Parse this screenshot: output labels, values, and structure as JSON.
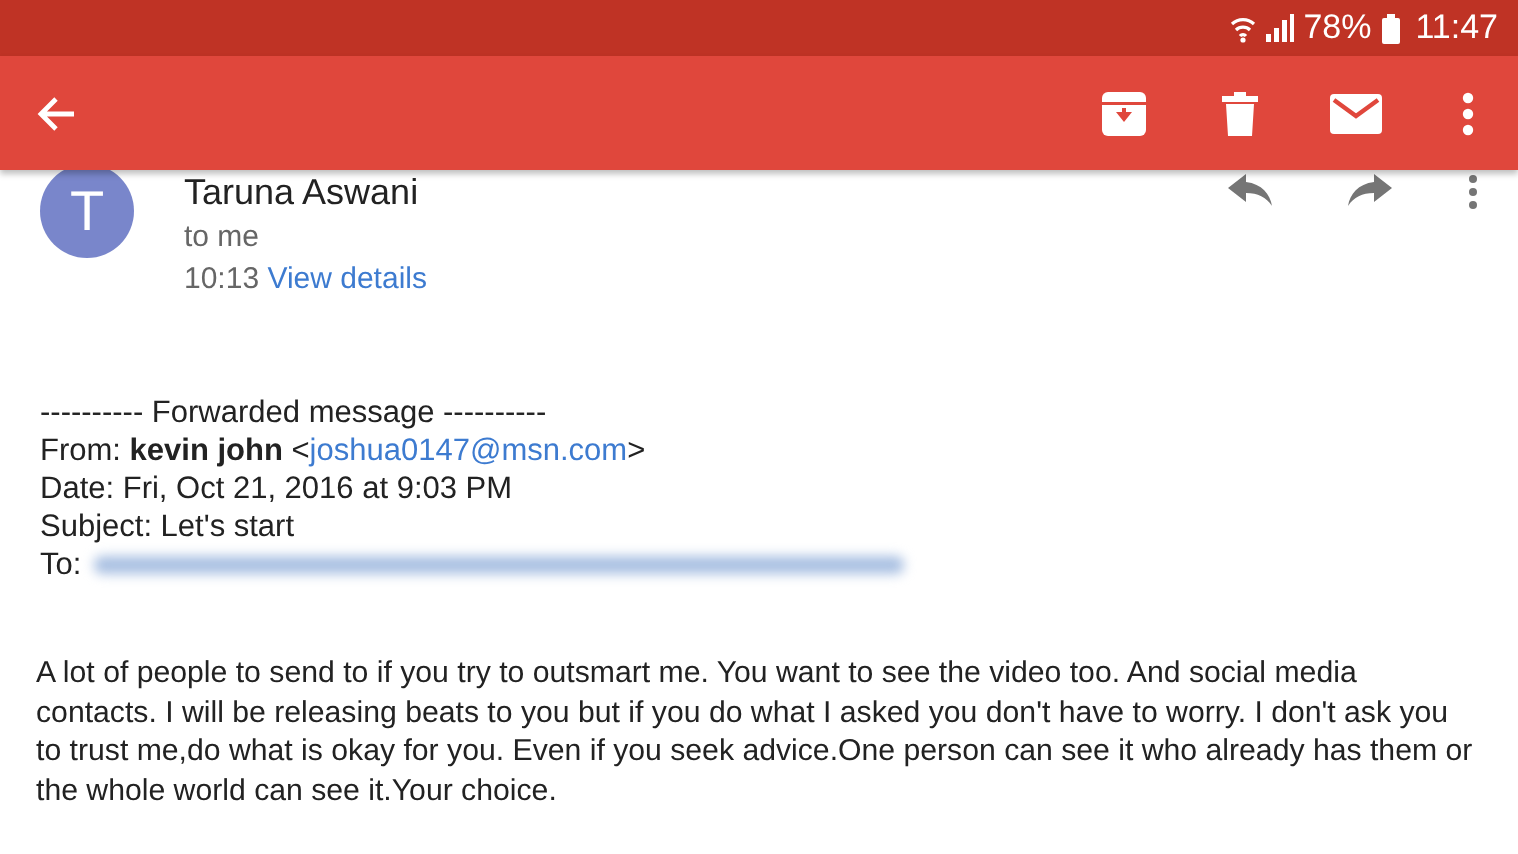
{
  "status_bar": {
    "battery": "78%",
    "time": "11:47"
  },
  "app_bar": {
    "actions": [
      {
        "kind": "archive"
      },
      {
        "kind": "delete"
      },
      {
        "kind": "mail"
      },
      {
        "kind": "more"
      }
    ]
  },
  "message": {
    "avatar_letter": "T",
    "sender": "Taruna Aswani",
    "recipient": "to me",
    "time": "10:13",
    "details_link": "View details",
    "forwarded_heading": "---------- Forwarded message ----------",
    "from_label": "From:",
    "from_name": "kevin john",
    "from_open": "<",
    "from_email": "joshua0147@msn.com",
    "from_close": ">",
    "date_line": "Date: Fri, Oct 21, 2016 at 9:03 PM",
    "subject_line": "Subject: Let's start",
    "to_label": "To:",
    "body": "A lot of people to send to if you try to outsmart me. You want to see the video too. And social media contacts. I will be releasing beats to you but if you do what I asked you don't have to worry. I don't ask you to trust me,do what is okay for you. Even if you seek advice.One person can see it who already has them or the whole world can see it.Your choice."
  }
}
